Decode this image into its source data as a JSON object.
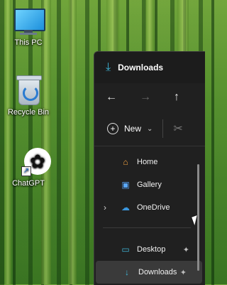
{
  "desktop": {
    "icons": [
      {
        "label": "This PC",
        "icon": "this-pc-icon"
      },
      {
        "label": "Recycle Bin",
        "icon": "recycle-bin-icon"
      },
      {
        "label": "ChatGPT",
        "icon": "chatgpt-icon"
      }
    ]
  },
  "explorer": {
    "title": "Downloads",
    "title_icon": "download-icon",
    "nav": {
      "back_icon": "←",
      "forward_icon": "→",
      "up_icon": "↑"
    },
    "toolbar": {
      "new_label": "New",
      "plus_glyph": "+",
      "dropdown_glyph": "⌄",
      "cut_glyph": "✂"
    },
    "nav_pane": {
      "items": [
        {
          "label": "Home",
          "icon": "home-icon",
          "glyph": "⌂"
        },
        {
          "label": "Gallery",
          "icon": "gallery-icon",
          "glyph": "▣"
        },
        {
          "label": "OneDrive",
          "icon": "onedrive-icon",
          "glyph": "☁",
          "expandable": true
        }
      ],
      "quick_access": [
        {
          "label": "Desktop",
          "icon": "desktop-icon",
          "glyph": "▭",
          "pinned": true
        },
        {
          "label": "Downloads",
          "icon": "download-icon",
          "glyph": "↓",
          "pinned": true,
          "selected": true
        }
      ],
      "expand_glyph": "›",
      "pin_glyph": "📌"
    }
  },
  "colors": {
    "explorer_bg": "#202020",
    "accent": "#3fb6d8",
    "selected_bg": "#3a3a3a"
  }
}
